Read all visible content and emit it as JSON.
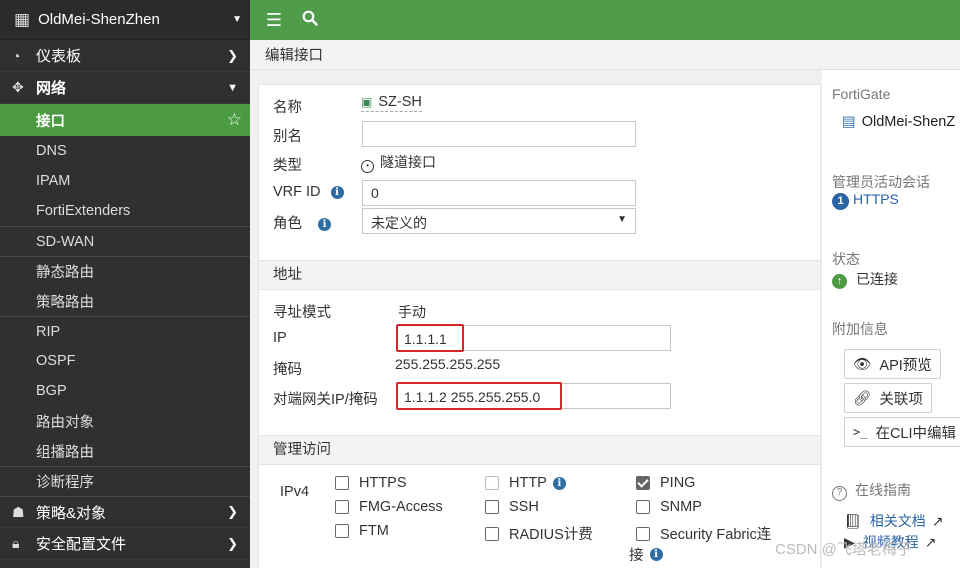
{
  "sidebar": {
    "device": "OldMei-ShenZhen",
    "items": {
      "dashboard": "仪表板",
      "network": "网络",
      "interfaces": "接口",
      "dns": "DNS",
      "ipam": "IPAM",
      "fortiextenders": "FortiExtenders",
      "sdwan": "SD-WAN",
      "static_routes": "静态路由",
      "policy_routes": "策略路由",
      "rip": "RIP",
      "ospf": "OSPF",
      "bgp": "BGP",
      "routing_objects": "路由对象",
      "multicast": "组播路由",
      "diagnostics": "诊断程序",
      "policy_objects": "策略&对象",
      "security_profiles": "安全配置文件"
    }
  },
  "topbar": {
    "menu_icon": "hamburger-icon",
    "search_icon": "search-icon"
  },
  "page": {
    "title": "编辑接口"
  },
  "form": {
    "name_label": "名称",
    "name_value": "SZ-SH",
    "alias_label": "别名",
    "alias_value": "",
    "type_label": "类型",
    "type_value": "隧道接口",
    "vrf_label": "VRF ID",
    "vrf_value": "0",
    "role_label": "角色",
    "role_value": "未定义的",
    "address_section": "地址",
    "addr_mode_label": "寻址模式",
    "addr_mode_value": "手动",
    "ip_label": "IP",
    "ip_value": "1.1.1.1",
    "mask_label": "掩码",
    "mask_value": "255.255.255.255",
    "peer_label": "对端网关IP/掩码",
    "peer_value": "1.1.1.2 255.255.255.0",
    "admin_section": "管理访问",
    "ipv4_label": "IPv4",
    "access": {
      "https": "HTTPS",
      "http": "HTTP",
      "ping": "PING",
      "fmg": "FMG-Access",
      "ssh": "SSH",
      "snmp": "SNMP",
      "ftm": "FTM",
      "radius": "RADIUS计费",
      "fabric_1": "Security Fabric连",
      "fabric_2": "接"
    }
  },
  "right": {
    "fortigate_label": "FortiGate",
    "device": "OldMei-ShenZ",
    "admin_sessions_label": "管理员活动会话",
    "sessions_count": "1",
    "sessions_proto": "HTTPS",
    "status_label": "状态",
    "status_value": "已连接",
    "extra_label": "附加信息",
    "api_preview": "API预览",
    "references": "关联项",
    "cli_edit": "在CLI中编辑",
    "guide_label": "在线指南",
    "docs_link": "相关文档",
    "video_link": "视频教程"
  },
  "watermark": "CSDN @飞塔老梅子",
  "colors": {
    "green": "#4f9d4b",
    "sidebar": "#303030",
    "highlight": "#d9262b"
  }
}
